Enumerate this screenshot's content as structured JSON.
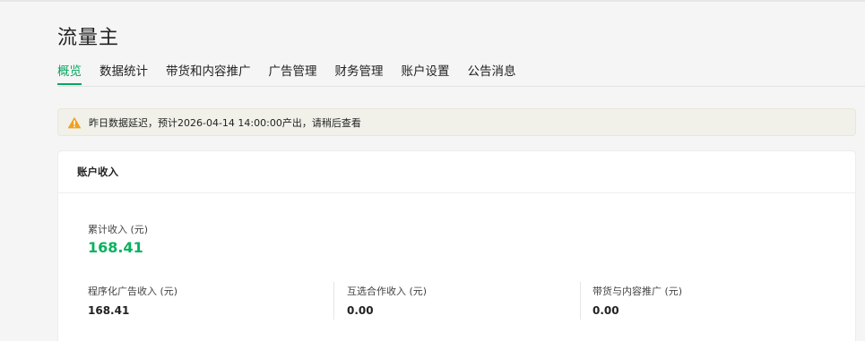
{
  "header": {
    "title": "流量主"
  },
  "tabs": [
    {
      "label": "概览",
      "active": true
    },
    {
      "label": "数据统计",
      "active": false
    },
    {
      "label": "带货和内容推广",
      "active": false
    },
    {
      "label": "广告管理",
      "active": false
    },
    {
      "label": "财务管理",
      "active": false
    },
    {
      "label": "账户设置",
      "active": false
    },
    {
      "label": "公告消息",
      "active": false
    }
  ],
  "notice": {
    "icon": "warning-icon",
    "text": "昨日数据延迟，预计2026-04-14 14:00:00产出，请稍后查看"
  },
  "income": {
    "title": "账户收入",
    "total_label": "累计收入 (元)",
    "total_value": "168.41",
    "metrics": [
      {
        "label": "程序化广告收入 (元)",
        "value": "168.41"
      },
      {
        "label": "互选合作收入 (元)",
        "value": "0.00"
      },
      {
        "label": "带货与内容推广 (元)",
        "value": "0.00"
      }
    ]
  },
  "colors": {
    "accent": "#07a65f",
    "total_value": "#07b35d",
    "warning": "#f0a020"
  }
}
